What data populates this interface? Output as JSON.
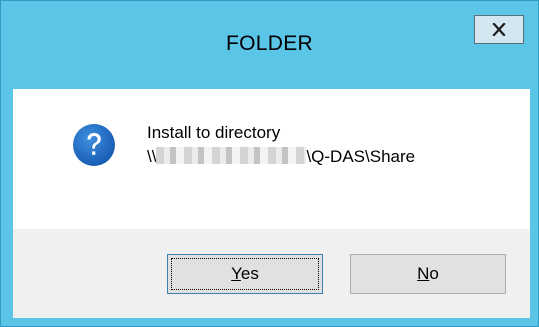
{
  "window": {
    "title": "FOLDER",
    "close_label": "x",
    "colors": {
      "frame": "#5bc5e8",
      "content_bg": "#ffffff",
      "footer_bg": "#f0f0f0",
      "icon_blue": "#1f6ec4"
    }
  },
  "message": {
    "icon": "question-icon",
    "line1": "Install to directory",
    "line2_prefix": "\\\\",
    "line2_suffix": "\\Q-DAS\\Share"
  },
  "buttons": {
    "yes": {
      "mnemonic": "Y",
      "rest": "es"
    },
    "no": {
      "mnemonic": "N",
      "rest": "o"
    }
  }
}
